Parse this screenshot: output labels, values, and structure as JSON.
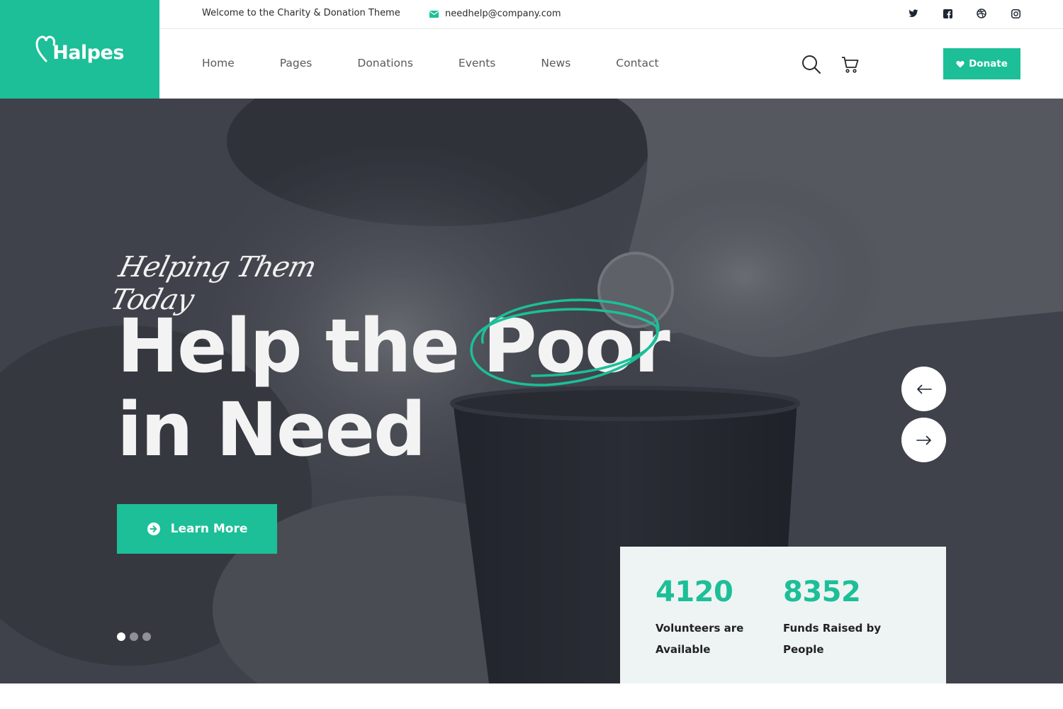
{
  "brand": {
    "name": "Halpes",
    "color": "#1cbf97"
  },
  "topbar": {
    "welcome": "Welcome to the Charity & Donation Theme",
    "email": "needhelp@company.com",
    "socials": [
      "twitter-icon",
      "facebook-icon",
      "dribbble-icon",
      "instagram-icon"
    ]
  },
  "nav": {
    "links": [
      "Home",
      "Pages",
      "Donations",
      "Events",
      "News",
      "Contact"
    ],
    "donate_label": "Donate"
  },
  "hero": {
    "tagline": "Helping Them Today",
    "headline_part1": "Help the ",
    "headline_highlight": "Poor",
    "headline_line2": "in Need",
    "cta_label": "Learn More",
    "slides": 3,
    "active_slide": 1
  },
  "stats": [
    {
      "value": "4120",
      "label": "Volunteers are Available"
    },
    {
      "value": "8352",
      "label": "Funds Raised by People"
    }
  ]
}
